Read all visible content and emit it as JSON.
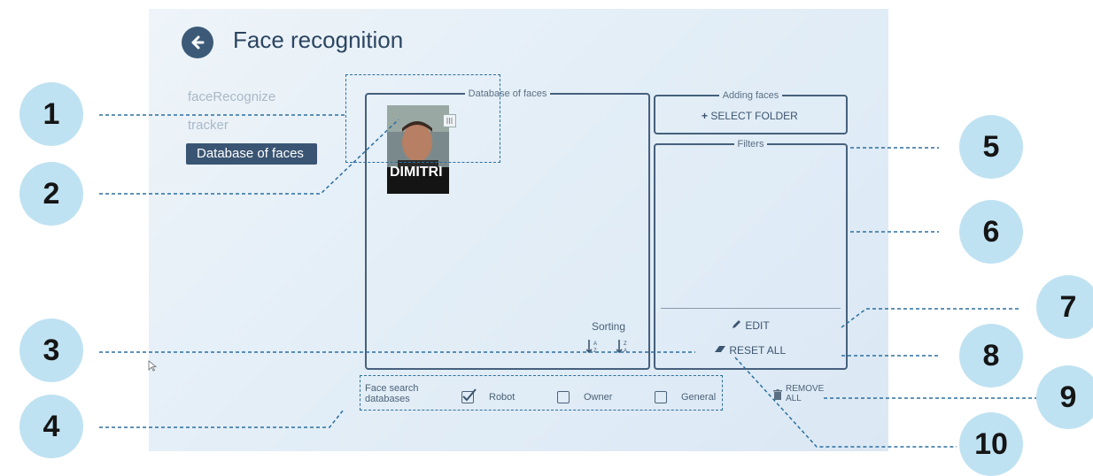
{
  "header": {
    "title": "Face recognition",
    "back_icon": "back-arrow-icon"
  },
  "sidebar": {
    "items": [
      {
        "label": "faceRecognize"
      },
      {
        "label": "tracker"
      },
      {
        "label": "Database of faces"
      }
    ]
  },
  "database_panel": {
    "legend": "Database of faces",
    "faces": [
      {
        "name": "DIMITRI"
      }
    ]
  },
  "sorting": {
    "label": "Sorting",
    "asc_icon": "sort-ascending-icon",
    "desc_icon": "sort-descending-icon"
  },
  "adding_panel": {
    "legend": "Adding faces",
    "select_folder": "SELECT FOLDER"
  },
  "filters_panel": {
    "legend": "Filters",
    "edit": "EDIT",
    "reset_all": "RESET ALL"
  },
  "search_db": {
    "label_line1": "Face search",
    "label_line2": "databases",
    "options": [
      {
        "label": "Robot",
        "checked": true
      },
      {
        "label": "Owner",
        "checked": false
      },
      {
        "label": "General",
        "checked": false
      }
    ]
  },
  "remove": {
    "line1": "REMOVE",
    "line2": "ALL"
  },
  "callouts": [
    "1",
    "2",
    "3",
    "4",
    "5",
    "6",
    "7",
    "8",
    "9",
    "10"
  ],
  "colors": {
    "accent": "#3a5573",
    "callout": "#bfe2f2",
    "leader": "#2b6f9e"
  }
}
